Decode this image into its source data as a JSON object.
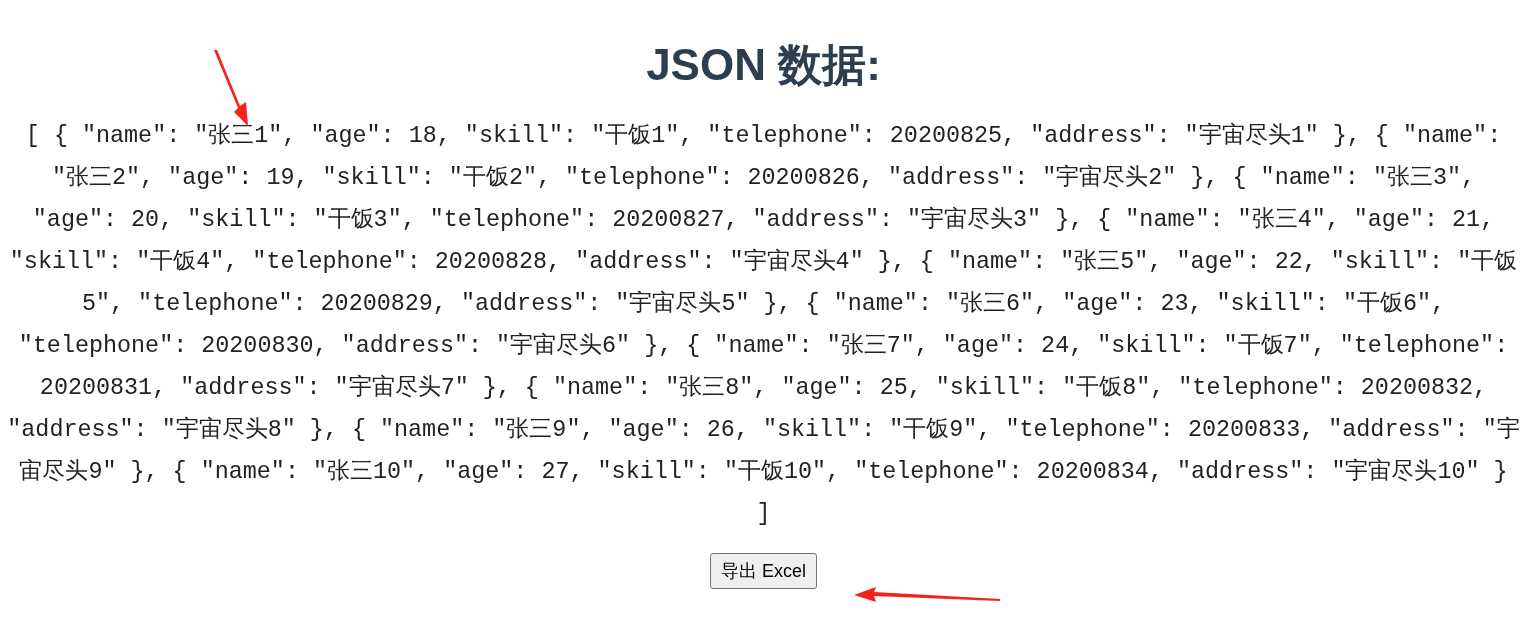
{
  "heading": "JSON 数据:",
  "json_text": "[ { \"name\": \"张三1\", \"age\": 18, \"skill\": \"干饭1\", \"telephone\": 20200825, \"address\": \"宇宙尽头1\" }, { \"name\": \"张三2\", \"age\": 19, \"skill\": \"干饭2\", \"telephone\": 20200826, \"address\": \"宇宙尽头2\" }, { \"name\": \"张三3\", \"age\": 20, \"skill\": \"干饭3\", \"telephone\": 20200827, \"address\": \"宇宙尽头3\" }, { \"name\": \"张三4\", \"age\": 21, \"skill\": \"干饭4\", \"telephone\": 20200828, \"address\": \"宇宙尽头4\" }, { \"name\": \"张三5\", \"age\": 22, \"skill\": \"干饭5\", \"telephone\": 20200829, \"address\": \"宇宙尽头5\" }, { \"name\": \"张三6\", \"age\": 23, \"skill\": \"干饭6\", \"telephone\": 20200830, \"address\": \"宇宙尽头6\" }, { \"name\": \"张三7\", \"age\": 24, \"skill\": \"干饭7\", \"telephone\": 20200831, \"address\": \"宇宙尽头7\" }, { \"name\": \"张三8\", \"age\": 25, \"skill\": \"干饭8\", \"telephone\": 20200832, \"address\": \"宇宙尽头8\" }, { \"name\": \"张三9\", \"age\": 26, \"skill\": \"干饭9\", \"telephone\": 20200833, \"address\": \"宇宙尽头9\" }, { \"name\": \"张三10\", \"age\": 27, \"skill\": \"干饭10\", \"telephone\": 20200834, \"address\": \"宇宙尽头10\" } ]",
  "export_button": "导出 Excel"
}
